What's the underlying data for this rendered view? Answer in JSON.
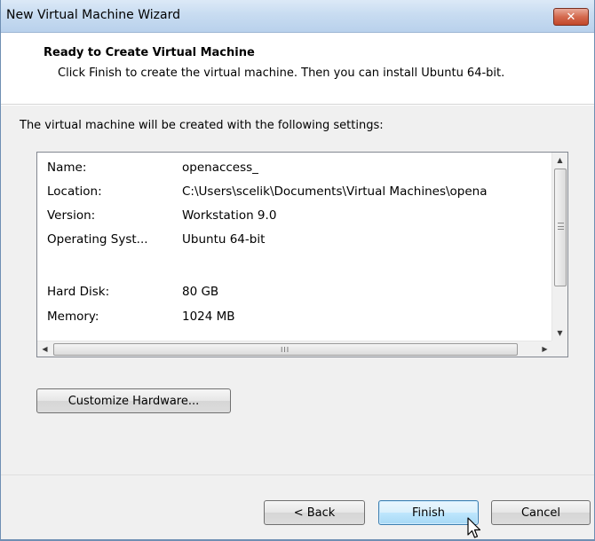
{
  "window": {
    "title": "New Virtual Machine Wizard",
    "close_glyph": "✕"
  },
  "header": {
    "title": "Ready to Create Virtual Machine",
    "subtitle": "Click Finish to create the virtual machine. Then you can install Ubuntu 64-bit."
  },
  "settings": {
    "intro": "The virtual machine will be created with the following settings:",
    "rows": [
      {
        "label": "Name:",
        "value": "openaccess_"
      },
      {
        "label": "Location:",
        "value": "C:\\Users\\scelik\\Documents\\Virtual Machines\\opena"
      },
      {
        "label": "Version:",
        "value": "Workstation 9.0"
      },
      {
        "label": "Operating Syst...",
        "value": "Ubuntu 64-bit"
      },
      {
        "label": "Hard Disk:",
        "value": "80 GB"
      },
      {
        "label": "Memory:",
        "value": "1024 MB"
      }
    ],
    "hscroll_grip": "III"
  },
  "buttons": {
    "customize": "Customize Hardware...",
    "back": "< Back",
    "finish": "Finish",
    "cancel": "Cancel"
  },
  "colors": {
    "titlebar": "#c8dcf1",
    "close": "#c2472a",
    "default_button": "#bee6fd"
  },
  "icons": [
    "close-icon",
    "scroll-up-arrow-icon",
    "scroll-down-arrow-icon",
    "scroll-left-arrow-icon",
    "scroll-right-arrow-icon",
    "mouse-pointer-icon"
  ]
}
